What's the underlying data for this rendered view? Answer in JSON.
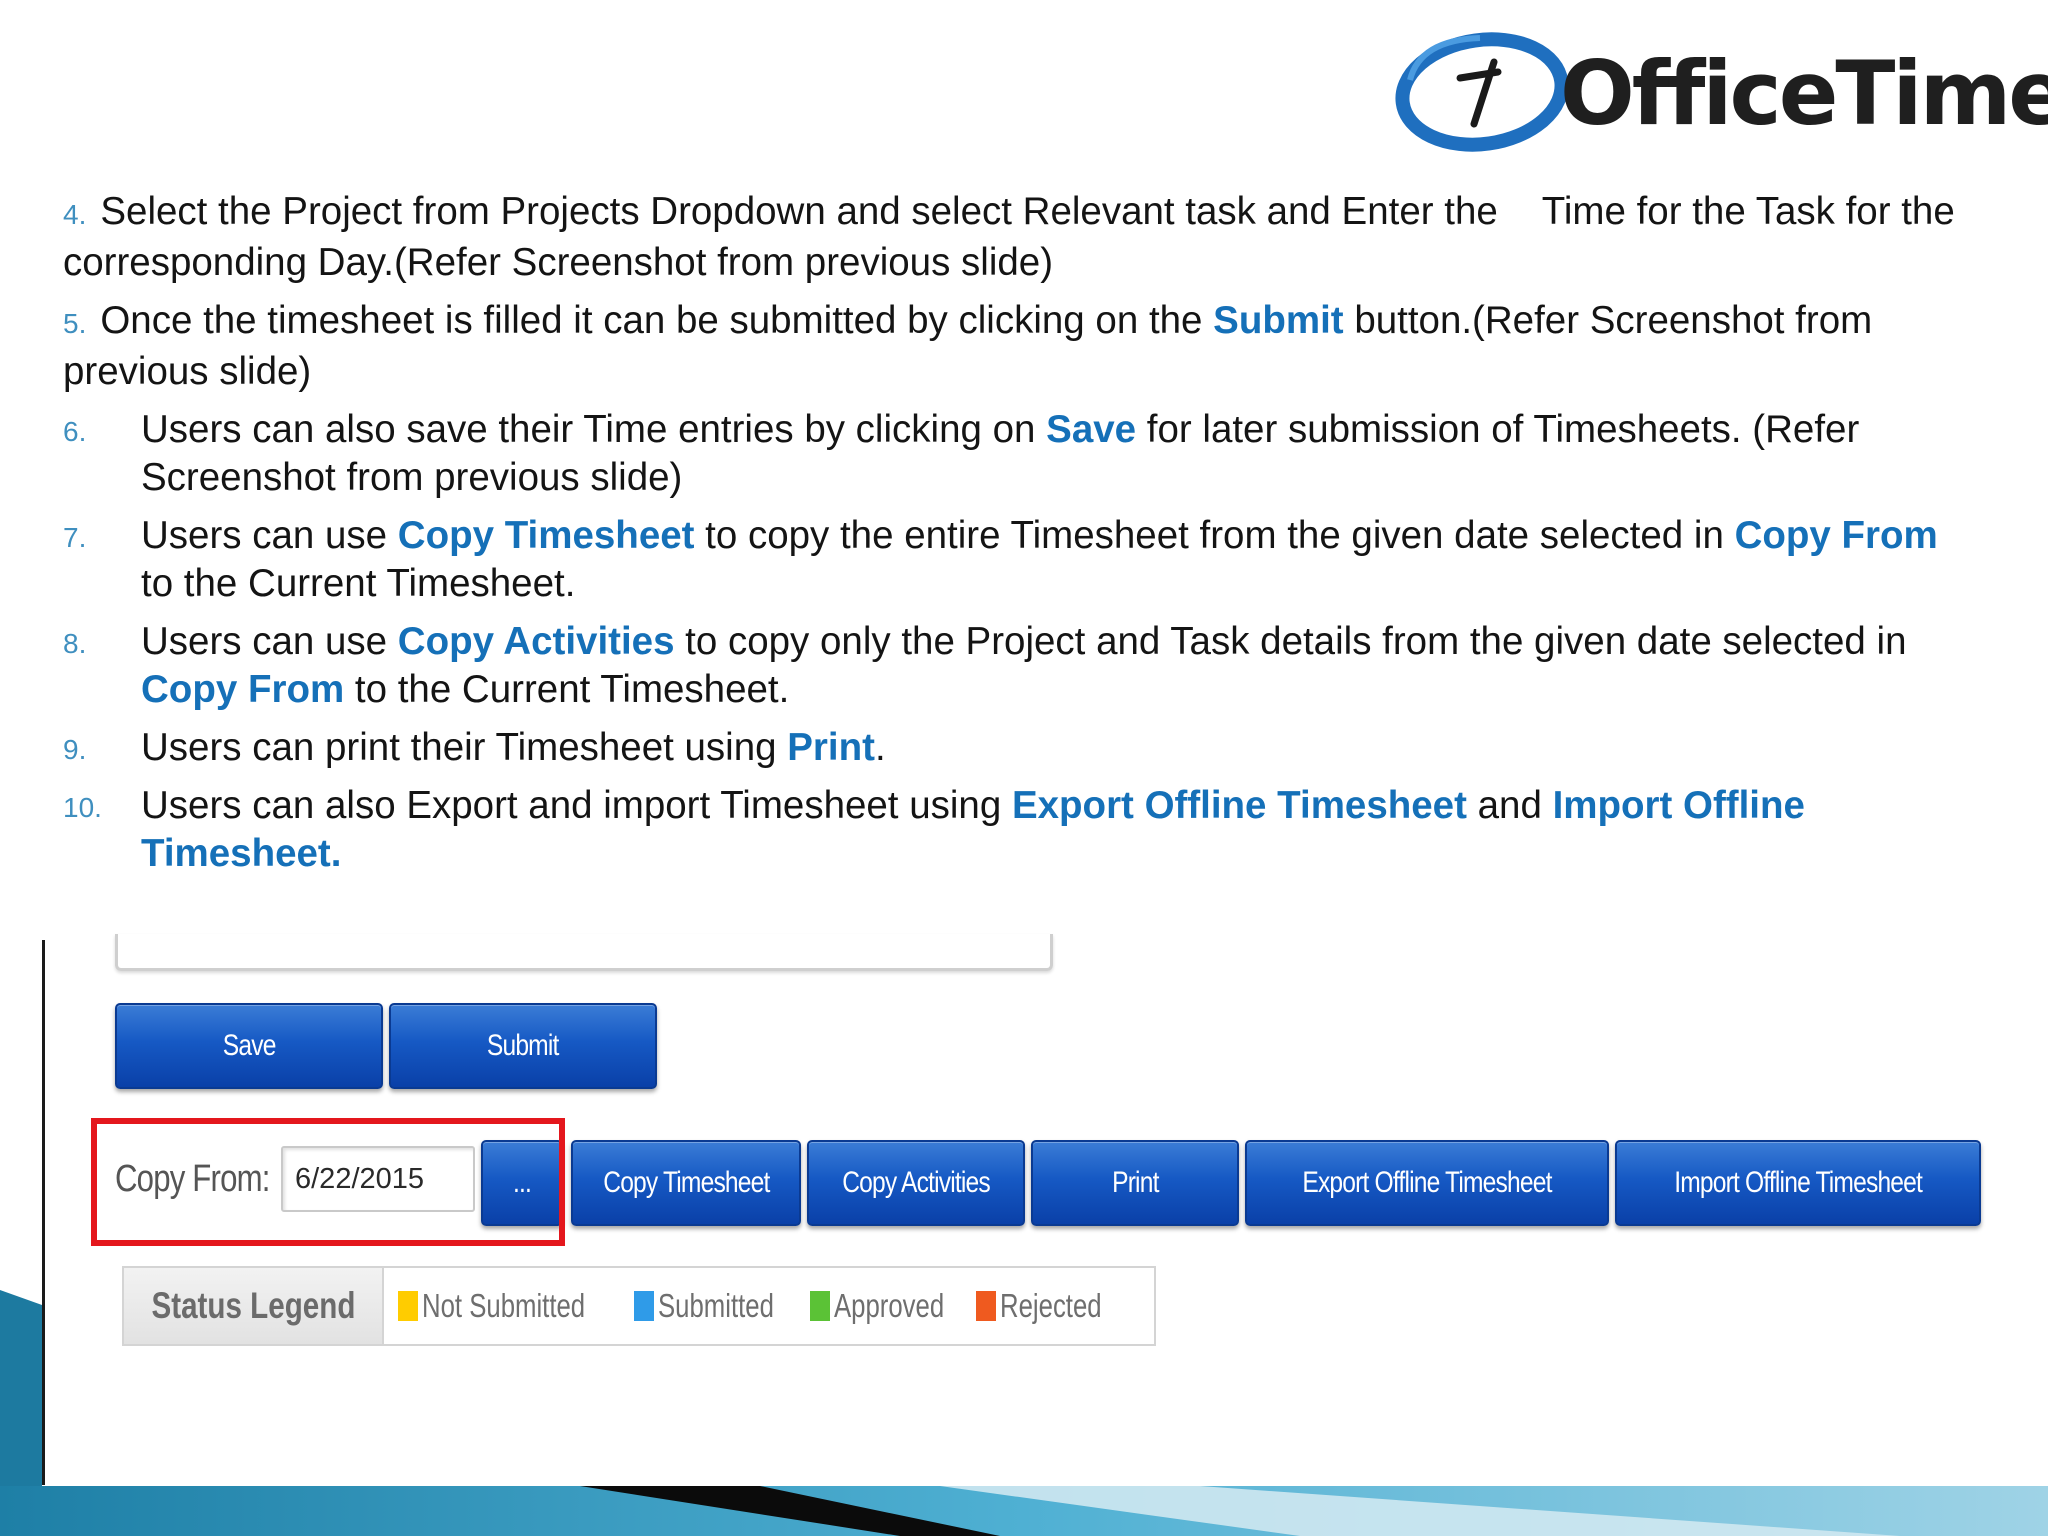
{
  "logo": {
    "text": "OfficeTimer",
    "colors": {
      "ring": "#1f6fbf",
      "text": "#1f1f1f"
    }
  },
  "steps": [
    {
      "num": "4.",
      "parts": [
        {
          "t": "Select the Project from Projects Dropdown and select Relevant task and Enter the"
        },
        {
          "t": "Time for the Task for the corresponding Day.(Refer Screenshot from previous slide)"
        }
      ]
    },
    {
      "num": "5.",
      "parts": [
        {
          "t": "Once the timesheet is filled it can be submitted by clicking on the "
        },
        {
          "t": "Submit",
          "k": true
        },
        {
          "t": " button.(Refer Screenshot from previous slide)"
        }
      ]
    },
    {
      "num": "6.",
      "parts": [
        {
          "t": "Users can also save their Time entries by clicking on "
        },
        {
          "t": "Save",
          "k": true
        },
        {
          "t": " for later submission of Timesheets. (Refer Screenshot from previous slide)"
        }
      ]
    },
    {
      "num": "7.",
      "parts": [
        {
          "t": "Users can use "
        },
        {
          "t": "Copy Timesheet",
          "k": true
        },
        {
          "t": " to copy the entire Timesheet from the given date selected in "
        },
        {
          "t": "Copy From",
          "k": true
        },
        {
          "t": " to the Current Timesheet."
        }
      ]
    },
    {
      "num": "8.",
      "parts": [
        {
          "t": "Users can use "
        },
        {
          "t": "Copy Activities",
          "k": true
        },
        {
          "t": " to copy only the Project and Task details from the given date selected in "
        },
        {
          "t": "Copy From",
          "k": true
        },
        {
          "t": " to the Current Timesheet."
        }
      ]
    },
    {
      "num": "9.",
      "parts": [
        {
          "t": "Users can print their Timesheet using "
        },
        {
          "t": "Print",
          "k": true
        },
        {
          "t": "."
        }
      ]
    },
    {
      "num": "10.",
      "parts": [
        {
          "t": "Users can also Export and import Timesheet using "
        },
        {
          "t": "Export Offline Timesheet",
          "k": true
        },
        {
          "t": " and "
        },
        {
          "t": "Import Offline Timesheet.",
          "k": true
        }
      ]
    }
  ],
  "screenshot": {
    "buttons": {
      "save": "Save",
      "submit": "Submit",
      "date_picker": "...",
      "copy_timesheet": "Copy Timesheet",
      "copy_activities": "Copy Activities",
      "print": "Print",
      "export_offline": "Export Offline Timesheet",
      "import_offline": "Import Offline Timesheet"
    },
    "copy_from": {
      "label": "Copy From:",
      "value": "6/22/2015"
    },
    "legend": {
      "title": "Status Legend",
      "items": [
        {
          "label": "Not Submitted",
          "color": "#ffcc00"
        },
        {
          "label": "Submitted",
          "color": "#2f9be8"
        },
        {
          "label": "Approved",
          "color": "#5bc236"
        },
        {
          "label": "Rejected",
          "color": "#ef5a1f"
        }
      ]
    },
    "highlight_color": "#e4171d"
  },
  "theme": {
    "keyword_color": "#1570b8",
    "number_color": "#3f8fbf",
    "button_blue": "#1659c4",
    "deco_teal": "#2a8fb5"
  }
}
